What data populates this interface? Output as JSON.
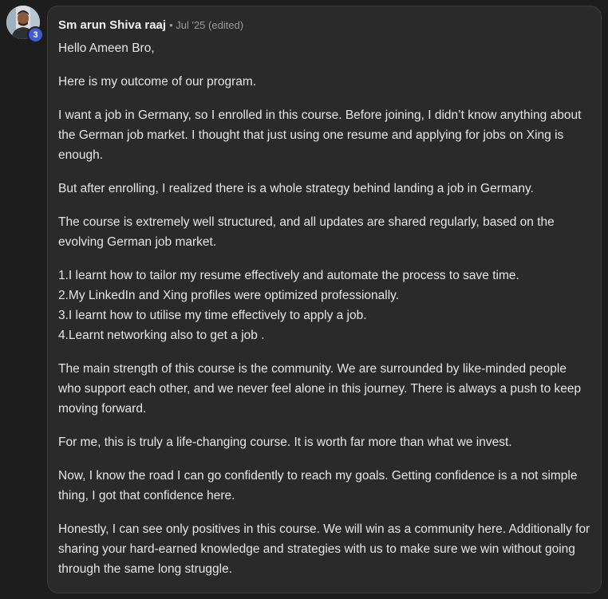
{
  "comment": {
    "author": "Sm arun Shiva raaj",
    "meta": "• Jul '25 (edited)",
    "level": "3",
    "paragraphs": [
      "Hello Ameen Bro,",
      "Here is my outcome of our program.",
      "I want a job in Germany, so I enrolled in this course. Before joining, I didn’t know anything about the German job market. I thought that just using one resume and applying for jobs on Xing is enough.",
      "But after enrolling, I realized there is a whole strategy behind landing a job in Germany.",
      "The course is extremely well structured, and all updates are shared regularly, based on the evolving German job market."
    ],
    "list": [
      "1.I learnt how to tailor my resume effectively and automate the process to save time.",
      "2.My LinkedIn and Xing profiles were optimized professionally.",
      "3.I learnt how to utilise my time effectively to apply a job.",
      "4.Learnt networking also to get a job ."
    ],
    "closing": [
      "The main strength of this course is the community. We are surrounded by like-minded people who support each other, and we never feel alone in this journey. There is always a push to keep moving forward.",
      "For me, this is truly a life-changing course. It is worth far more than what we invest.",
      "Now, I know the road I can go confidently to reach my goals. Getting confidence is a not simple thing, I got that confidence here.",
      "Honestly, I can see only positives in this course. We will win as a community here. Additionally for sharing your hard-earned knowledge and strategies with us to make sure we win without going through the same long struggle."
    ]
  },
  "colors": {
    "background": "#1d1d1d",
    "card": "#2a2a2a",
    "badge": "#3f5bd6"
  }
}
